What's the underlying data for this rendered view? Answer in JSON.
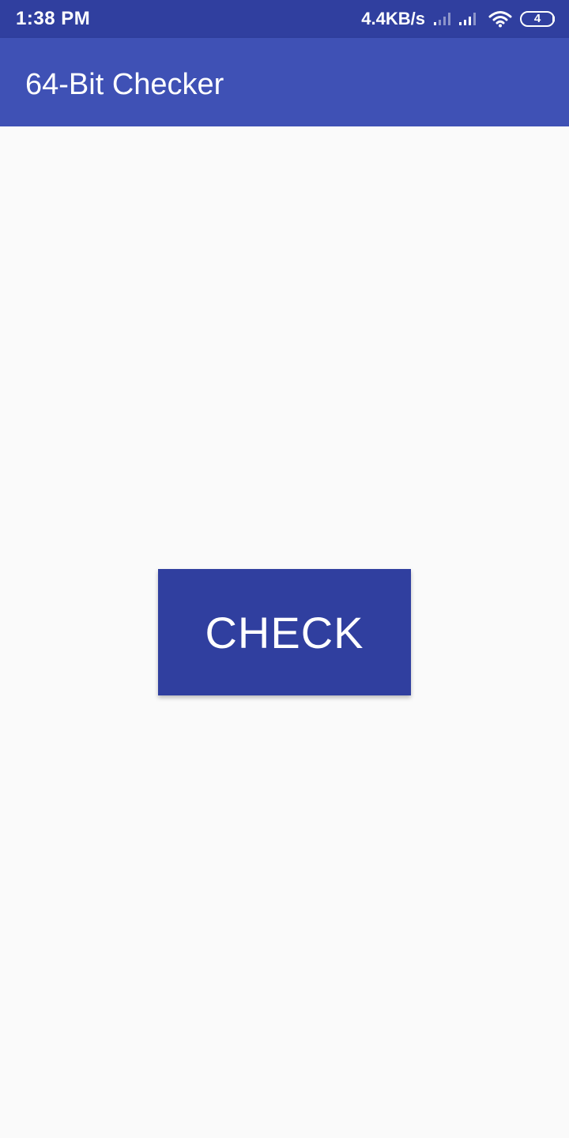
{
  "status_bar": {
    "time": "1:38 PM",
    "net_speed": "4.4KB/s",
    "battery_level": "4",
    "icons": [
      "signal-icon",
      "signal-icon",
      "wifi-icon",
      "battery-icon"
    ]
  },
  "app_bar": {
    "title": "64-Bit Checker"
  },
  "main": {
    "check_button_label": "CHECK"
  },
  "colors": {
    "status_bar": "#303f9f",
    "app_bar": "#3f51b5",
    "button": "#303f9f",
    "background": "#fafafa"
  }
}
